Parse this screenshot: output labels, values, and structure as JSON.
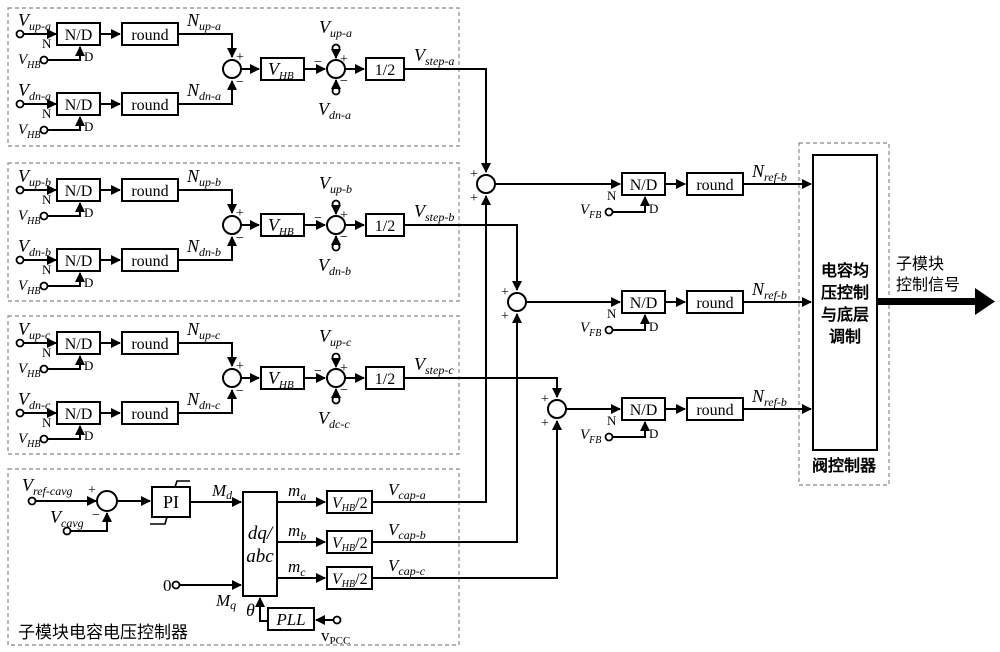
{
  "blocks": {
    "nd": "N/D",
    "round": "round",
    "half": "1/2",
    "vhb_block": "V",
    "vhb_block_sub": "HB",
    "pi": "PI",
    "dqabc_1": "dq/",
    "dqabc_2": "abc",
    "pll": "PLL",
    "vhb_half_v": "V",
    "vhb_half_sub": "HB",
    "vhb_half_tail": "/2"
  },
  "ports": {
    "n": "N",
    "d": "D",
    "plus": "+",
    "minus": "−"
  },
  "phases": [
    {
      "vup": "V",
      "vup_sub": "up-a",
      "vdn": "V",
      "vdn_sub": "dn-a",
      "vhb": "V",
      "vhb_sub": "HB",
      "nup": "N",
      "nup_sub": "up-a",
      "ndn": "N",
      "ndn_sub": "dn-a",
      "vup2": "V",
      "vup2_sub": "up-a",
      "vdn2": "V",
      "vdn2_sub": "dn-a",
      "vstep": "V",
      "vstep_sub": "step-a"
    },
    {
      "vup": "V",
      "vup_sub": "up-b",
      "vdn": "V",
      "vdn_sub": "dn-b",
      "vhb": "V",
      "vhb_sub": "HB",
      "nup": "N",
      "nup_sub": "up-b",
      "ndn": "N",
      "ndn_sub": "dn-b",
      "vup2": "V",
      "vup2_sub": "up-b",
      "vdn2": "V",
      "vdn2_sub": "dn-b",
      "vstep": "V",
      "vstep_sub": "step-b"
    },
    {
      "vup": "V",
      "vup_sub": "up-c",
      "vdn": "V",
      "vdn_sub": "dn-c",
      "vhb": "V",
      "vhb_sub": "HB",
      "nup": "N",
      "nup_sub": "up-c",
      "ndn": "N",
      "ndn_sub": "dn-c",
      "vup2": "V",
      "vup2_sub": "up-c",
      "vdn2": "V",
      "vdn2_sub": "dc-c",
      "vstep": "V",
      "vstep_sub": "step-c"
    }
  ],
  "right_chain": [
    {
      "vfb": "V",
      "vfb_sub": "FB",
      "nref": "N",
      "nref_sub": "ref-b"
    },
    {
      "vfb": "V",
      "vfb_sub": "FB",
      "nref": "N",
      "nref_sub": "ref-b"
    },
    {
      "vfb": "V",
      "vfb_sub": "FB",
      "nref": "N",
      "nref_sub": "ref-b"
    }
  ],
  "controller": {
    "vref": "V",
    "vref_sub": "ref-cavg",
    "vcavg": "V",
    "vcavg_sub": "cavg",
    "md": "M",
    "md_sub": "d",
    "mq": "M",
    "mq_sub": "q",
    "zero": "0",
    "theta": "θ",
    "vpcc": "v",
    "vpcc_sub": "PCC",
    "ma": "m",
    "ma_sub": "a",
    "mb": "m",
    "mb_sub": "b",
    "mc": "m",
    "mc_sub": "c",
    "vcap_a": "V",
    "vcap_a_sub": "cap-a",
    "vcap_b": "V",
    "vcap_b_sub": "cap-b",
    "vcap_c": "V",
    "vcap_c_sub": "cap-c",
    "title": "子模块电容电压控制器"
  },
  "valve": {
    "inner_lines": [
      "电容均",
      "压控制",
      "与底层",
      "调制"
    ],
    "title": "阀控制器",
    "output_lines": [
      "子模块",
      "控制信号"
    ]
  }
}
